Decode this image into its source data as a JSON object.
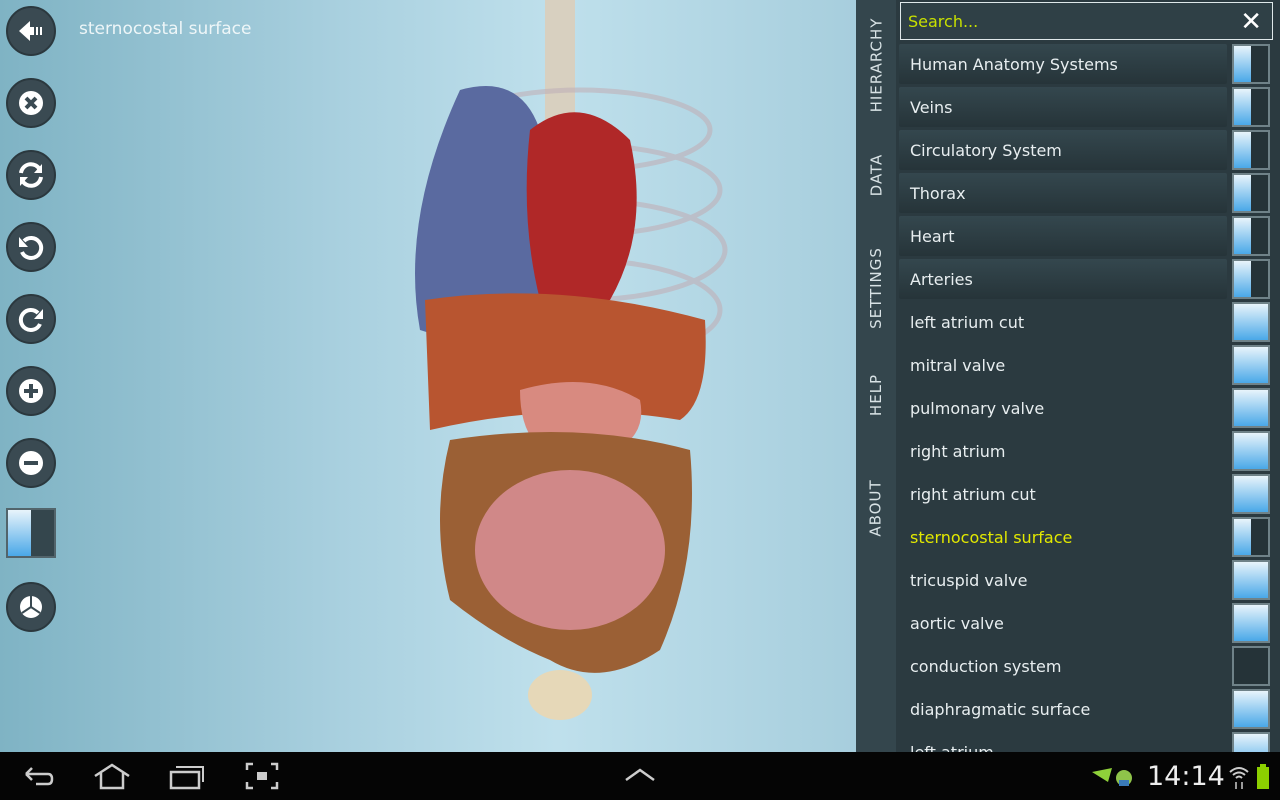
{
  "viewport": {
    "title": "sternocostal surface"
  },
  "toolbar": [
    "back-button",
    "close-button",
    "reset-view-button",
    "rotate-left-button",
    "rotate-right-button",
    "zoom-in-button",
    "zoom-out-button",
    "transparency-toggle",
    "pie-button"
  ],
  "side_tabs": [
    "HIERARCHY",
    "DATA",
    "SETTINGS",
    "HELP",
    "ABOUT"
  ],
  "search": {
    "placeholder": "Search...",
    "clear": "✕"
  },
  "list": [
    {
      "label": "Human Anatomy Systems",
      "group": true,
      "toggle": "half"
    },
    {
      "label": "Veins",
      "group": true,
      "toggle": "half"
    },
    {
      "label": "Circulatory System",
      "group": true,
      "toggle": "half"
    },
    {
      "label": "Thorax",
      "group": true,
      "toggle": "half"
    },
    {
      "label": "Heart",
      "group": true,
      "toggle": "half"
    },
    {
      "label": "Arteries",
      "group": true,
      "toggle": "half"
    },
    {
      "label": "left atrium cut",
      "toggle": "full"
    },
    {
      "label": "mitral valve",
      "toggle": "full"
    },
    {
      "label": "pulmonary valve",
      "toggle": "full"
    },
    {
      "label": "right atrium",
      "toggle": "full"
    },
    {
      "label": "right atrium cut",
      "toggle": "full"
    },
    {
      "label": "sternocostal surface",
      "toggle": "half",
      "selected": true
    },
    {
      "label": "tricuspid valve",
      "toggle": "full"
    },
    {
      "label": "aortic valve",
      "toggle": "full"
    },
    {
      "label": "conduction system",
      "toggle": "off"
    },
    {
      "label": "diaphragmatic surface",
      "toggle": "full"
    },
    {
      "label": "left atrium",
      "toggle": "full"
    }
  ],
  "status": {
    "time": "14:14"
  },
  "colors": {
    "accent": "#c8e000",
    "toggle_on": "#4aa8e8",
    "panel": "#2b3a40"
  }
}
